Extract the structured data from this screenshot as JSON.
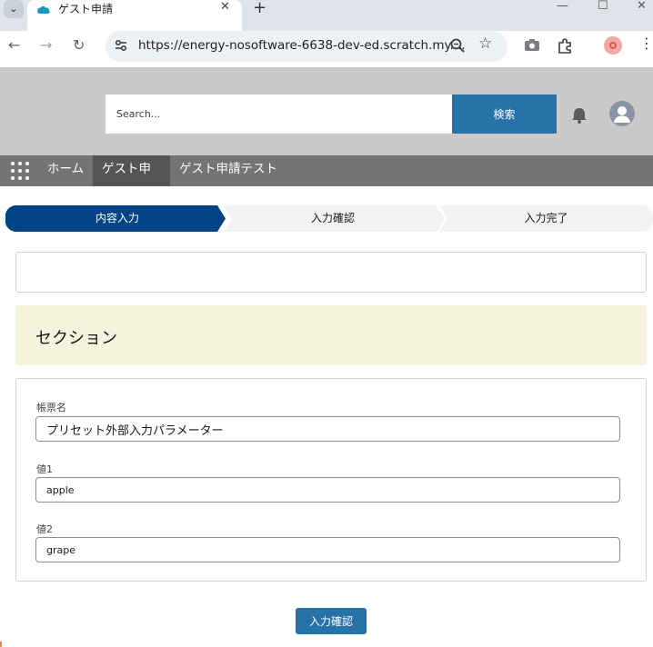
{
  "browser": {
    "tab_title": "ゲスト申請",
    "url": "https://energy-nosoftware-6638-dev-ed.scratch.my....",
    "icons": [
      "tab-menu-icon",
      "salesforce-cloud-icon",
      "close-icon",
      "plus-icon",
      "minimize-icon",
      "maximize-icon",
      "close-window-icon",
      "back-icon",
      "forward-icon",
      "reload-icon",
      "site-info-icon",
      "zoom-icon",
      "star-icon",
      "camera-icon",
      "extensions-icon",
      "profile-icon",
      "kebab-menu-icon"
    ]
  },
  "header": {
    "search_placeholder": "Search...",
    "search_button": "検索"
  },
  "nav": {
    "items": [
      {
        "label": "ホーム",
        "active": false
      },
      {
        "label": "ゲスト申請",
        "active": true
      },
      {
        "label": "ゲスト申請テスト",
        "active": false
      }
    ]
  },
  "path": {
    "steps": [
      {
        "label": "内容入力",
        "current": true
      },
      {
        "label": "入力確認",
        "current": false
      },
      {
        "label": "入力完了",
        "current": false
      }
    ]
  },
  "section": {
    "title": "セクション"
  },
  "form": {
    "fields": [
      {
        "label": "帳票名",
        "value": "プリセット外部入力パラメーター"
      },
      {
        "label": "値1",
        "value": "apple"
      },
      {
        "label": "値2",
        "value": "grape"
      }
    ]
  },
  "actions": {
    "confirm_label": "入力確認"
  },
  "colors": {
    "brand_blue": "#2872aa",
    "path_active": "#014486",
    "section_bg": "#f4f4dc",
    "header_bg": "#c9c9c9",
    "nav_bg": "#747474"
  }
}
